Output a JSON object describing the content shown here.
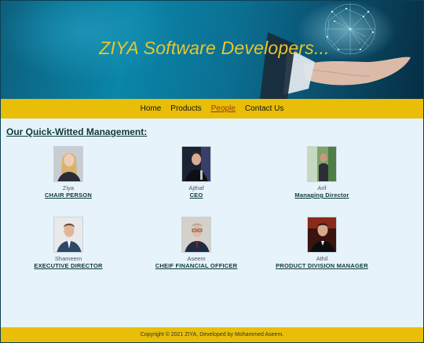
{
  "banner": {
    "title": "ZIYA Software Developers..."
  },
  "nav": {
    "items": [
      {
        "label": "Home",
        "active": false
      },
      {
        "label": "Products",
        "active": false
      },
      {
        "label": "People",
        "active": true
      },
      {
        "label": "Contact Us",
        "active": false
      }
    ]
  },
  "main": {
    "heading": "Our Quick-Witted Management:",
    "members": [
      {
        "name": "Ziya",
        "role": "CHAIR PERSON"
      },
      {
        "name": "Ajthaf",
        "role": "CEO"
      },
      {
        "name": "Arif",
        "role": "Managing Director"
      },
      {
        "name": "Shameem",
        "role": "EXECUTIVE DIRECTOR"
      },
      {
        "name": "Aseem",
        "role": "CHEIF FINANCIAL OFFICER"
      },
      {
        "name": "Athil",
        "role": "PRODUCT DIVISION MANAGER"
      }
    ]
  },
  "footer": {
    "text": "Copyright © 2021 ZIYA, Developed by Mohammed Aseem."
  },
  "colors": {
    "accent_yellow": "#e8be08",
    "banner_title": "#e9c52b",
    "page_background": "#e6f3fb",
    "heading_color": "#0f3a3a",
    "active_nav": "#a0361f"
  }
}
